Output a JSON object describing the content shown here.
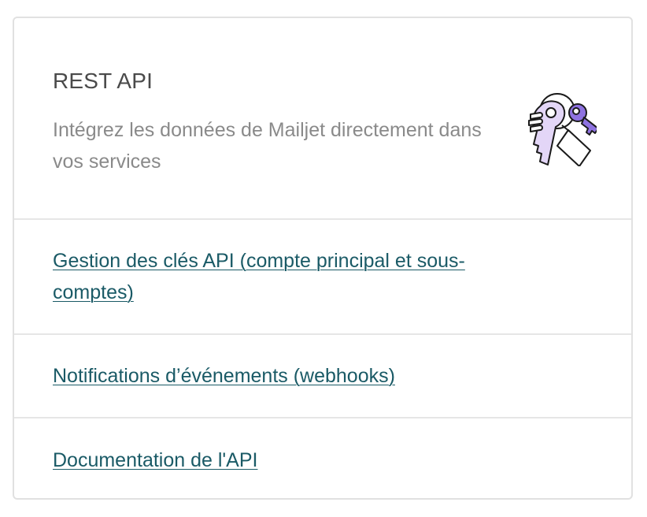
{
  "card": {
    "title": "REST API",
    "subtitle": "Intégrez les données de Mailjet directement dans vos services",
    "illustration_icon": "keys-icon",
    "links": [
      {
        "label": "Gestion des clés API (compte principal et sous-comptes)"
      },
      {
        "label": "Notifications d’événements (webhooks)"
      },
      {
        "label": "Documentation de l'API"
      }
    ]
  },
  "colors": {
    "title": "#4a4a4a",
    "subtitle": "#8a8a8a",
    "link": "#1a5a66",
    "border": "#e1e1e1",
    "key_light": "#e3d6f7",
    "key_accent": "#8e72e0"
  }
}
